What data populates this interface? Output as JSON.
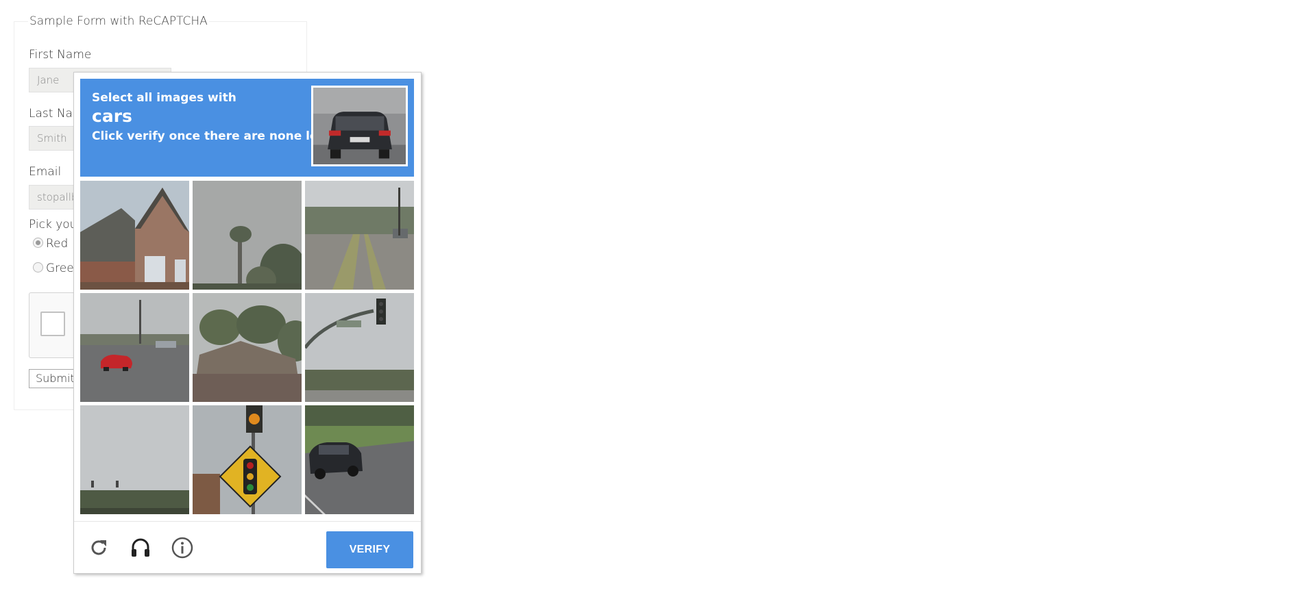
{
  "form": {
    "legend": "Sample Form with ReCAPTCHA",
    "first_name_label": "First Name",
    "first_name_value": "Jane",
    "last_name_label": "Last Nar",
    "last_name_value": "Smith",
    "email_label": "Email",
    "email_value": "stopallb",
    "pick_label": "Pick you",
    "radio_options": [
      {
        "label": "Red",
        "checked": true
      },
      {
        "label": "Greer",
        "checked": false
      }
    ],
    "submit_label": "Submit"
  },
  "challenge": {
    "header_color": "#4a90e2",
    "instruction_line1": "Select all images with",
    "keyword": "cars",
    "instruction_line2": "Click verify once there are none left",
    "tiles": [
      {
        "scene": "brick-house-roof"
      },
      {
        "scene": "palm-tree-fog"
      },
      {
        "scene": "road-lane-trees"
      },
      {
        "scene": "intersection-red-car"
      },
      {
        "scene": "trees-rooftop"
      },
      {
        "scene": "traffic-signal-pole"
      },
      {
        "scene": "sky-treeline"
      },
      {
        "scene": "traffic-light-sign"
      },
      {
        "scene": "dark-suv-road"
      }
    ],
    "footer": {
      "reload_icon": "reload-icon",
      "audio_icon": "headphones-icon",
      "info_icon": "info-icon",
      "verify_label": "VERIFY"
    }
  }
}
